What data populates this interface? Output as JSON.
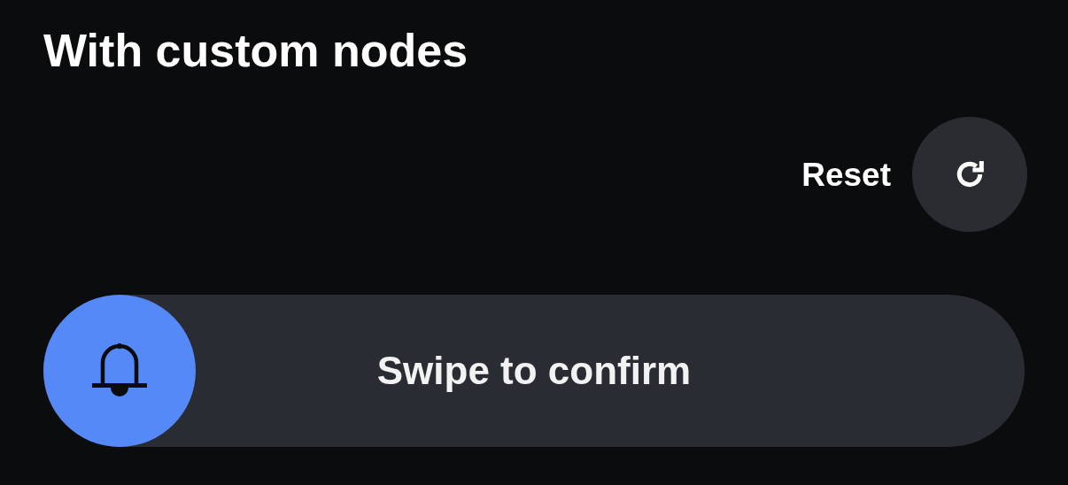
{
  "title": "With custom nodes",
  "reset": {
    "label": "Reset"
  },
  "swipe": {
    "label": "Swipe to confirm",
    "level": 0
  }
}
